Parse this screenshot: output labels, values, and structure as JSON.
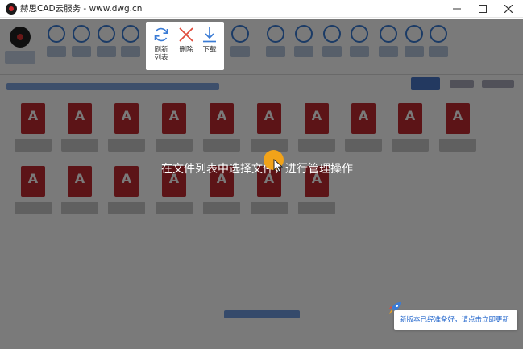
{
  "window": {
    "title": "赫思CAD云服务 - www.dwg.cn"
  },
  "spotlight": {
    "buttons": [
      {
        "label": "刷新\n列表",
        "icon": "refresh-icon"
      },
      {
        "label": "删除",
        "icon": "delete-x-icon"
      },
      {
        "label": "下载",
        "icon": "download-icon"
      }
    ]
  },
  "overlay": {
    "instruction": "在文件列表中选择文件，进行管理操作"
  },
  "notice": {
    "text": "新版本已经准备好，请点击立即更新"
  },
  "colors": {
    "accent": "#3a7bd5",
    "delete": "#e04a3a",
    "hint": "#f2a319",
    "file_icon": "#c02b30"
  }
}
